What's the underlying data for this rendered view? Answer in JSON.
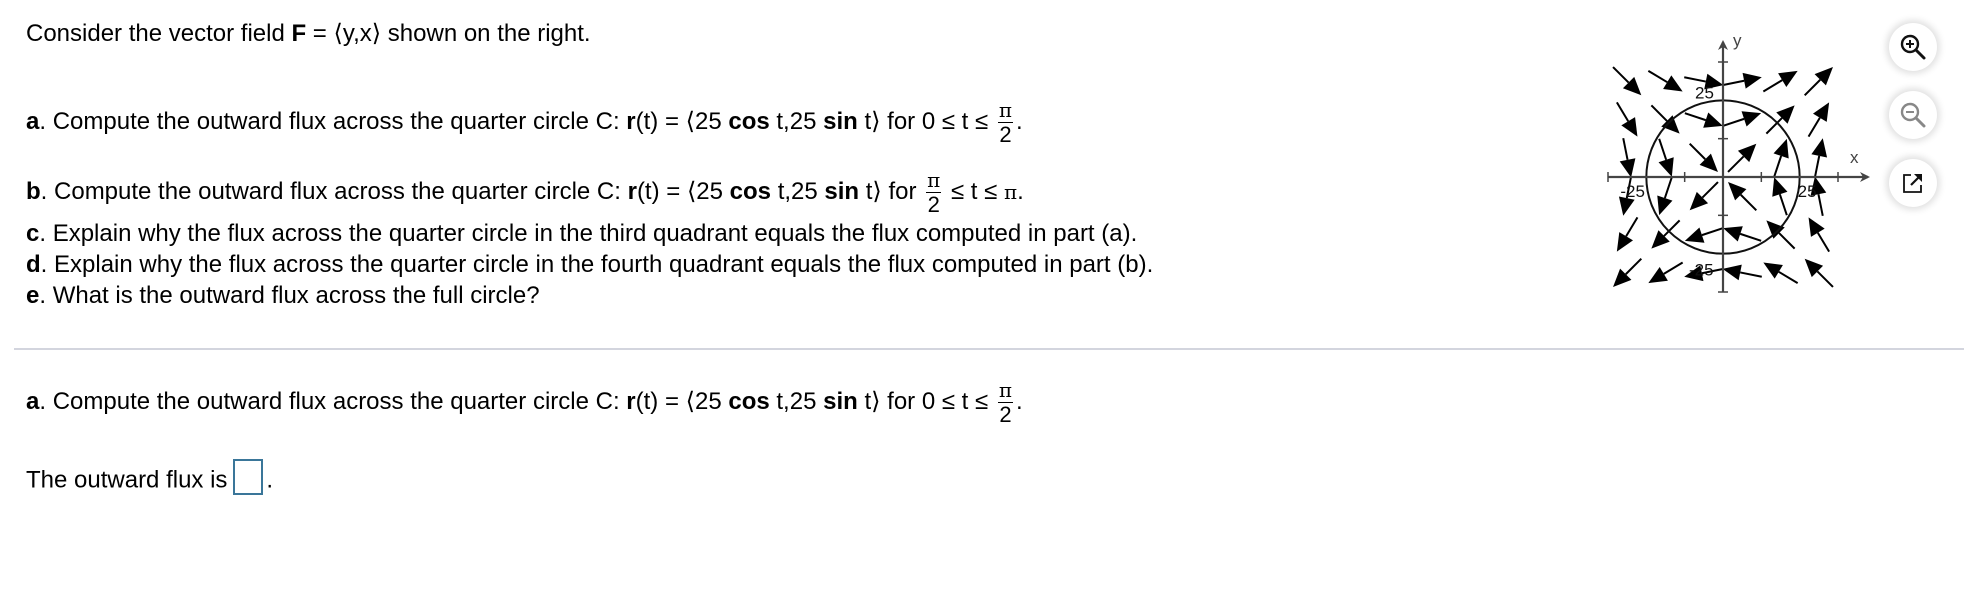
{
  "problem": {
    "intro": {
      "prefix": "Consider the vector field ",
      "bold_F": "F",
      "middle": " = ",
      "field": "⟨y,x⟩",
      "suffix": "  shown on the right."
    },
    "parts": [
      {
        "letter": "a",
        "text_before": ". Compute the outward flux across the quarter circle C: ",
        "r_bold": "r",
        "r_arg": "(t) = ⟨25 ",
        "cos_bold": "cos",
        "mid": " t,25 ",
        "sin_bold": "sin",
        "end": " t⟩  for 0 ≤ t ≤ ",
        "frac_num": "π",
        "frac_den": "2",
        "after_frac": "."
      },
      {
        "letter": "b",
        "text_before": ". Compute the outward flux across the quarter circle C: ",
        "r_bold": "r",
        "r_arg": "(t) = ⟨25 ",
        "cos_bold": "cos",
        "mid": " t,25 ",
        "sin_bold": "sin",
        "end": " t⟩  for ",
        "frac_num": "π",
        "frac_den": "2",
        "after_frac": " ≤ t ≤ ",
        "pi": "π",
        "final": "."
      },
      {
        "letter": "c",
        "text": ". Explain why the flux across the quarter circle in the third quadrant equals the flux computed in part (a)."
      },
      {
        "letter": "d",
        "text": ". Explain why the flux across the quarter circle in the fourth quadrant equals the flux computed in part (b)."
      },
      {
        "letter": "e",
        "text": ". What is the outward flux across the full circle?"
      }
    ]
  },
  "current_part": {
    "letter": "a",
    "text_before": ". Compute the outward flux across the quarter circle C: ",
    "r_bold": "r",
    "r_arg": "(t) = ⟨25 ",
    "cos_bold": "cos",
    "mid": " t,25 ",
    "sin_bold": "sin",
    "end": " t⟩  for 0 ≤ t ≤ ",
    "frac_num": "π",
    "frac_den": "2",
    "after_frac": "."
  },
  "answer": {
    "label": "The outward flux is",
    "value": "",
    "suffix": "."
  },
  "figure": {
    "field": "F = ⟨y, x⟩",
    "x_label": "x",
    "y_label": "y",
    "circle_radius": 25,
    "axis_range": [
      -37.5,
      37.5
    ],
    "ticks": [
      -37.5,
      -12.5,
      12.5,
      37.5
    ],
    "tick_labels": {
      "x_neg": "-25",
      "x_pos": "25",
      "y_pos": "25",
      "y_neg": "-25"
    },
    "arrow_grid": [
      -31.25,
      -18.75,
      -6.25,
      6.25,
      18.75,
      31.25
    ]
  },
  "toolbar": {
    "zoom_in": "zoom-in",
    "zoom_out": "zoom-out",
    "popout": "open-in-new-window"
  },
  "colors": {
    "divider": "#d3d5de",
    "answer_border": "#3a7699",
    "axis": "#444444"
  }
}
